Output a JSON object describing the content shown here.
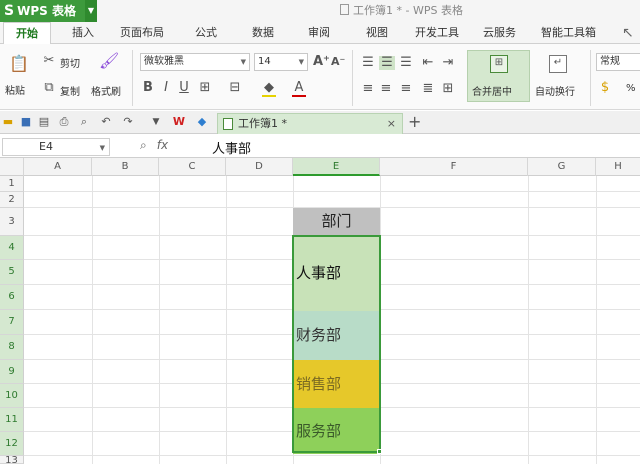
{
  "app": {
    "name": "WPS 表格",
    "document_title": "工作簿1 * - WPS 表格"
  },
  "menu_tabs": [
    "开始",
    "插入",
    "页面布局",
    "公式",
    "数据",
    "审阅",
    "视图",
    "开发工具",
    "云服务",
    "智能工具箱"
  ],
  "ribbon": {
    "paste": "粘贴",
    "cut": "剪切",
    "copy": "复制",
    "format_painter": "格式刷",
    "font_name": "微软雅黑",
    "font_size": "14",
    "merge_center": "合并居中",
    "wrap_text": "自动换行",
    "number_format": "常规",
    "percent": "%"
  },
  "doc_tab": {
    "label": "工作簿1 *",
    "close": "×",
    "new": "+"
  },
  "formula_bar": {
    "cell_ref": "E4",
    "fx": "fx",
    "value": "人事部"
  },
  "columns": [
    "A",
    "B",
    "C",
    "D",
    "E",
    "F",
    "G",
    "H"
  ],
  "rows": [
    "1",
    "2",
    "3",
    "4",
    "5",
    "6",
    "7",
    "8",
    "9",
    "10",
    "11",
    "12",
    "13"
  ],
  "cells": {
    "header": {
      "text": "部门",
      "bg": "#c0c0c0"
    },
    "groups": [
      {
        "text": "人事部",
        "bg": "#c8e2b8",
        "color": "#111111"
      },
      {
        "text": "财务部",
        "bg": "#b8dcc8",
        "color": "#333333"
      },
      {
        "text": "销售部",
        "bg": "#e6c82a",
        "color": "#7a6a22"
      },
      {
        "text": "服务部",
        "bg": "#8ed05a",
        "color": "#3a5a2a"
      }
    ]
  },
  "colors": {
    "accent": "#3d9a3c",
    "selection": "#3a9a3a"
  }
}
